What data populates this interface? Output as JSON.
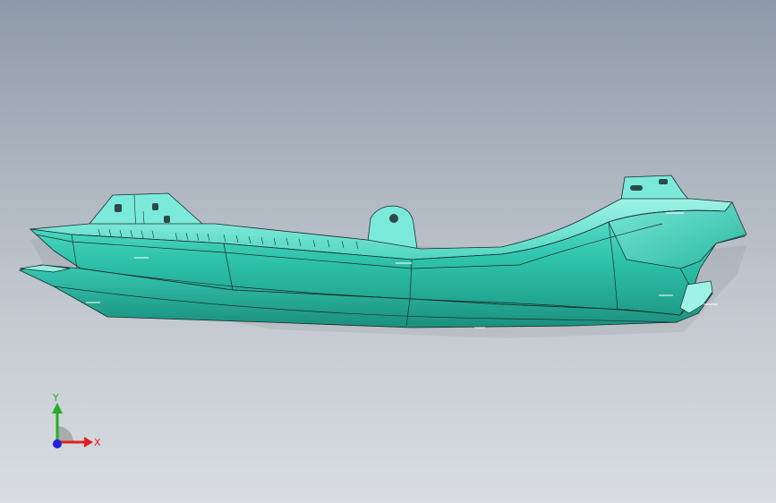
{
  "viewport": {
    "background_top": "#8f9aa8",
    "background_bottom": "#d9dde1"
  },
  "model": {
    "part_color": "#2fc4ad",
    "part_light": "#8eeee0",
    "part_dark": "#1a8f7d",
    "edge_color": "#1a2a28"
  },
  "triad": {
    "x_label": "X",
    "y_label": "Y",
    "x_color": "#e02020",
    "y_color": "#22b022",
    "z_color": "#2020e0"
  }
}
